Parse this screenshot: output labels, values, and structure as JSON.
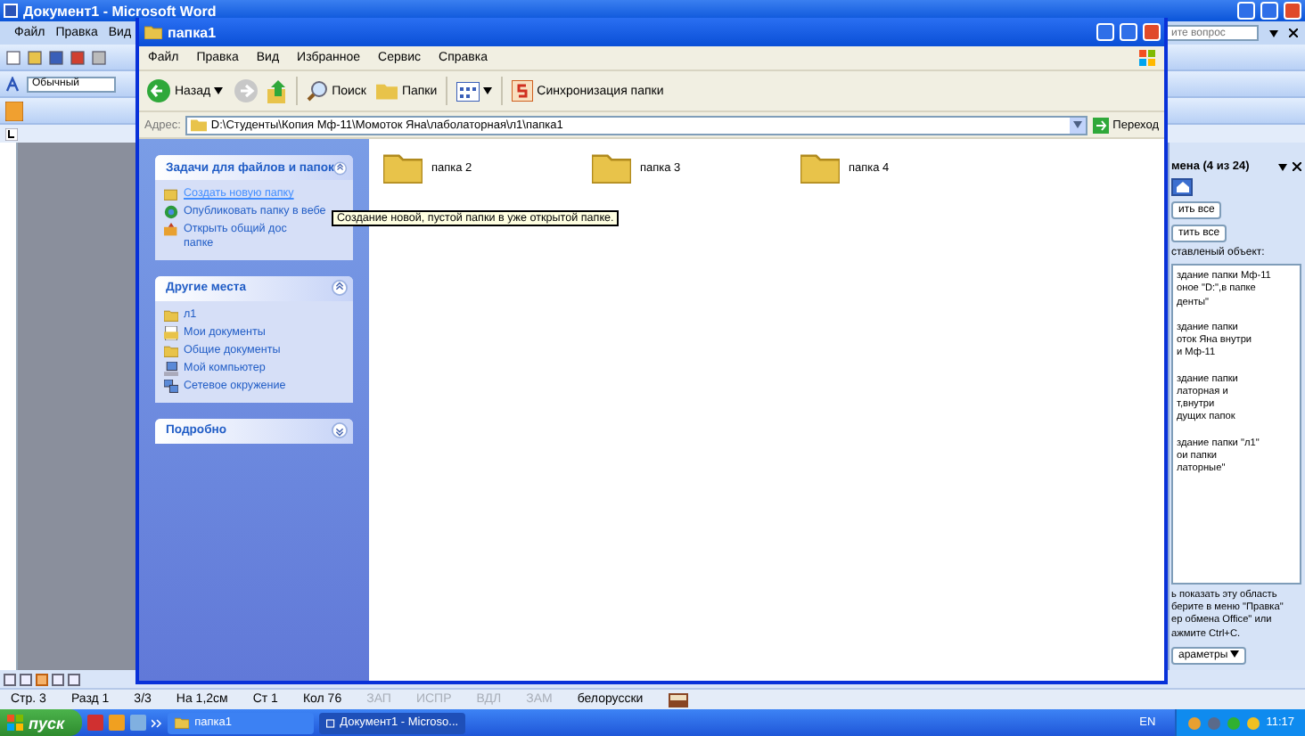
{
  "word": {
    "title": "Документ1 - Microsoft Word",
    "menu": [
      "Файл",
      "Правка",
      "Вид"
    ],
    "style_box": "Обычный",
    "help_box": {
      "placeholder": "ите вопрос"
    },
    "task_pane": {
      "title": "мена (4 из 24)",
      "paste_all": "ить все",
      "clear_all": "тить все",
      "list_label": "ставленый объект:",
      "items": [
        {
          "text": "здание папки Мф-11\nоное \"D:\",в папке\nденты\""
        },
        {
          "text": "здание папки\nоток Яна внутри\nи Мф-11"
        },
        {
          "text": "здание папки\nлаторная и\nт,внутри\nдущих папок"
        },
        {
          "text": "здание папки \"л1\"\nои папки\nлаторные\""
        }
      ],
      "hint": "ь показать эту область\nберите в меню \"Правка\"\nер обмена Office\" или\nажмите Ctrl+C.",
      "options": "араметры"
    },
    "status_bar": [
      {
        "text": "Стр. 3",
        "disabled": false
      },
      {
        "text": "Разд 1",
        "disabled": false
      },
      {
        "text": "3/3",
        "disabled": false
      },
      {
        "text": "На 1,2см",
        "disabled": false
      },
      {
        "text": "Ст 1",
        "disabled": false
      },
      {
        "text": "Кол 76",
        "disabled": false
      },
      {
        "text": "ЗАП",
        "disabled": true
      },
      {
        "text": "ИСПР",
        "disabled": true
      },
      {
        "text": "ВДЛ",
        "disabled": true
      },
      {
        "text": "ЗАМ",
        "disabled": true
      },
      {
        "text": "белорусски",
        "disabled": false
      }
    ]
  },
  "explorer": {
    "title": "папка1",
    "menu": [
      "Файл",
      "Правка",
      "Вид",
      "Избранное",
      "Сервис",
      "Справка"
    ],
    "toolbar": {
      "back": "Назад",
      "forward_disabled": true,
      "search": "Поиск",
      "folders": "Папки",
      "sync": "Синхронизация папки"
    },
    "address": {
      "label": "Адрес:",
      "value": "D:\\Студенты\\Копия Мф-11\\Момоток Яна\\лаболаторная\\л1\\папка1",
      "go": "Переход"
    },
    "sections": [
      {
        "title": "Задачи для файлов и папок",
        "expanded": true,
        "items": [
          {
            "text": "Создать новую папку",
            "hovered": true
          },
          {
            "text": "Опубликовать папку в вебе",
            "hovered": false
          },
          {
            "text": "Открыть общий дос\nпапке",
            "hovered": false
          }
        ]
      },
      {
        "title": "Другие места",
        "expanded": true,
        "items": [
          {
            "text": "л1",
            "hovered": false
          },
          {
            "text": "Мои документы",
            "hovered": false
          },
          {
            "text": "Общие документы",
            "hovered": false
          },
          {
            "text": "Мой компьютер",
            "hovered": false
          },
          {
            "text": "Сетевое окружение",
            "hovered": false
          }
        ]
      },
      {
        "title": "Подробно",
        "expanded": false
      }
    ],
    "folders": [
      "папка 2",
      "папка 3",
      "папка 4"
    ]
  },
  "tooltip": "Создание новой, пустой папки в уже открытой папке.",
  "taskbar": {
    "start": "пуск",
    "tasks": [
      {
        "label": "папка1",
        "selected": false
      },
      {
        "label": "Документ1 - Microso...",
        "selected": true
      }
    ],
    "language": "EN",
    "clock": "11:17"
  }
}
